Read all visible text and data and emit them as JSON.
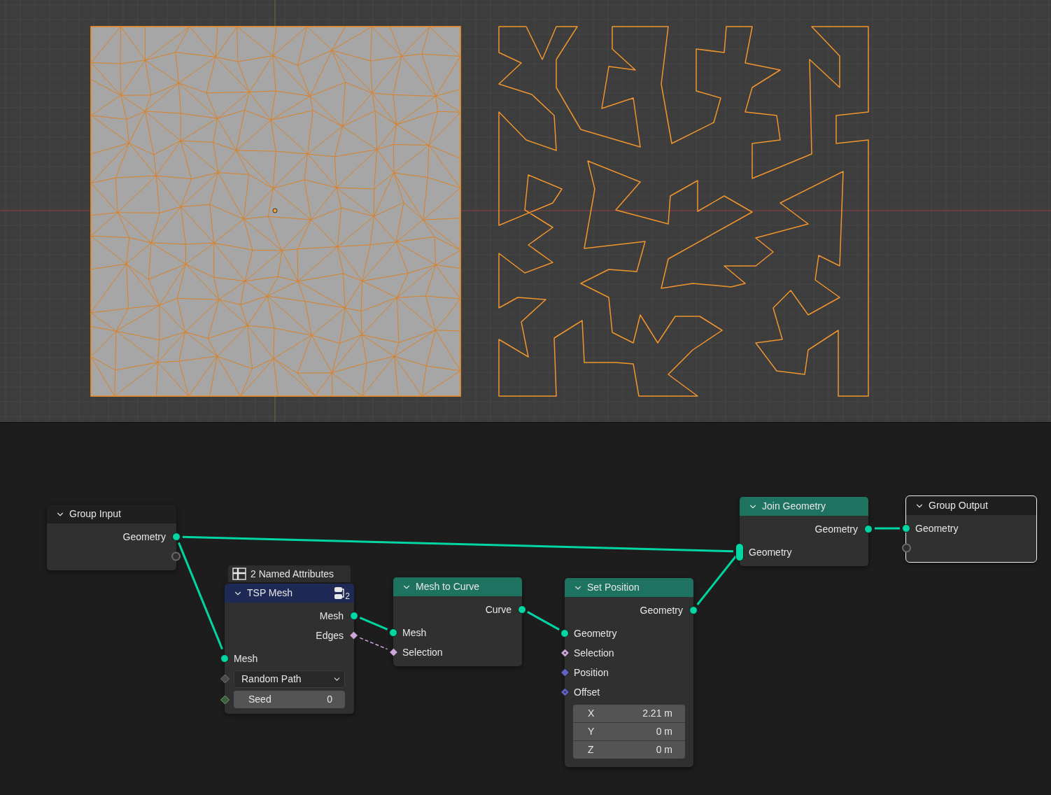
{
  "nodes": [
    {
      "title": "Group Input",
      "kind": "group",
      "selected": false,
      "rows": [
        {
          "kind": "output",
          "label": "Geometry",
          "socket": {
            "kind": "geometry"
          }
        },
        {
          "kind": "output",
          "socket": {
            "kind": "empty"
          }
        }
      ]
    },
    {
      "title": "TSP Mesh",
      "kind": "group-node",
      "selected": false,
      "badge": "2 Named Attributes",
      "user_count": "2",
      "rows": [
        {
          "kind": "output",
          "label": "Mesh",
          "socket": {
            "kind": "geometry"
          }
        },
        {
          "kind": "output",
          "label": "Edges",
          "socket": {
            "kind": "field"
          }
        },
        {
          "kind": "input",
          "label": "Mesh",
          "socket": {
            "kind": "geometry"
          }
        },
        {
          "kind": "dropdown",
          "value": "Random Path",
          "socket": {
            "kind": "menu"
          }
        },
        {
          "kind": "number",
          "label": "Seed",
          "value": "0",
          "socket": {
            "kind": "integer"
          }
        }
      ]
    },
    {
      "title": "Mesh to Curve",
      "kind": "geometry",
      "selected": false,
      "rows": [
        {
          "kind": "output",
          "label": "Curve",
          "socket": {
            "kind": "geometry"
          }
        },
        {
          "kind": "input",
          "label": "Mesh",
          "socket": {
            "kind": "geometry"
          }
        },
        {
          "kind": "input",
          "label": "Selection",
          "socket": {
            "kind": "field"
          }
        }
      ]
    },
    {
      "title": "Set Position",
      "kind": "geometry",
      "selected": false,
      "rows": [
        {
          "kind": "output",
          "label": "Geometry",
          "socket": {
            "kind": "geometry"
          }
        },
        {
          "kind": "input",
          "label": "Geometry",
          "socket": {
            "kind": "geometry"
          }
        },
        {
          "kind": "input",
          "label": "Selection",
          "socket": {
            "kind": "field-dot"
          }
        },
        {
          "kind": "input",
          "label": "Position",
          "socket": {
            "kind": "vector"
          }
        },
        {
          "kind": "input",
          "label": "Offset",
          "socket": {
            "kind": "vector-dot"
          }
        },
        {
          "kind": "vector",
          "components": [
            {
              "axis": "X",
              "value": "2.21 m"
            },
            {
              "axis": "Y",
              "value": "0 m"
            },
            {
              "axis": "Z",
              "value": "0 m"
            }
          ]
        }
      ]
    },
    {
      "title": "Join Geometry",
      "kind": "geometry",
      "selected": false,
      "rows": [
        {
          "kind": "output",
          "label": "Geometry",
          "socket": {
            "kind": "geometry"
          }
        },
        {
          "kind": "input",
          "label": "Geometry",
          "socket": {
            "kind": "geometry-multi"
          }
        }
      ]
    },
    {
      "title": "Group Output",
      "kind": "group",
      "selected": true,
      "rows": [
        {
          "kind": "input",
          "label": "Geometry",
          "socket": {
            "kind": "geometry"
          }
        },
        {
          "kind": "input",
          "socket": {
            "kind": "empty"
          }
        }
      ]
    }
  ]
}
